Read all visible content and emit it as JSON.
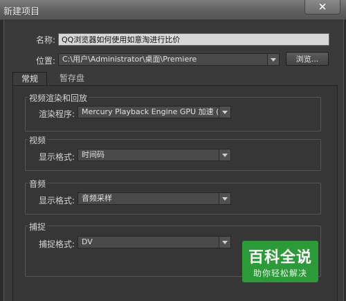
{
  "window": {
    "title": "新建项目",
    "close_glyph": "✕"
  },
  "form": {
    "name_label": "名称:",
    "name_value": "QQ浏览器如何使用如意淘进行比价",
    "location_label": "位置:",
    "location_value": "C:\\用户\\Administrator\\桌面\\Premiere",
    "browse_label": "浏览..."
  },
  "tabs": [
    {
      "label": "常规",
      "active": true
    },
    {
      "label": "暂存盘",
      "active": false
    }
  ],
  "groups": {
    "render": {
      "title": "视频渲染和回放",
      "label": "渲染程序:",
      "value": "Mercury Playback Engine GPU 加速 (O..."
    },
    "video": {
      "title": "视频",
      "label": "显示格式:",
      "value": "时间码"
    },
    "audio": {
      "title": "音频",
      "label": "显示格式:",
      "value": "音频采样"
    },
    "capture": {
      "title": "捕捉",
      "label": "捕捉格式:",
      "value": "DV"
    }
  },
  "watermark": {
    "main": "百科全说",
    "sub": "助你轻松解决",
    "color": "#2d9a3a"
  }
}
